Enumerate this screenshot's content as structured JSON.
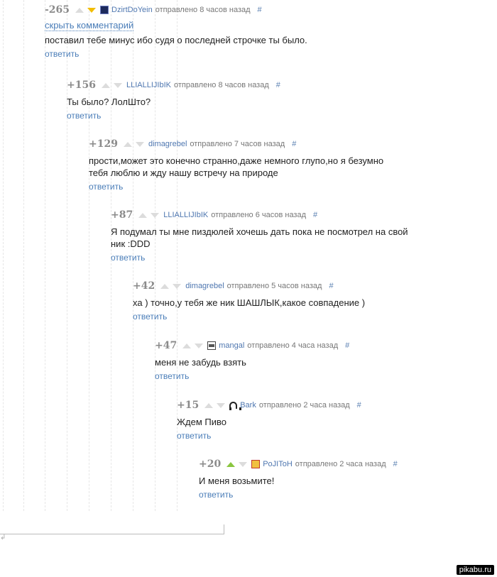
{
  "comments": [
    {
      "rating": "-265",
      "author": "DzirtDoYein",
      "posted": "отправлено 8 часов назад",
      "hash": "#",
      "hide_label": "скрыть комментарий",
      "text": "поставил тебе минус ибо судя о последней строчке ты было.",
      "reply": "ответить",
      "vote": "down",
      "avatar_icon": "night-sky-avatar"
    },
    {
      "rating": "+156",
      "author": "LLIALLIJIbIK",
      "posted": "отправлено 8 часов назад",
      "hash": "#",
      "text": "Ты было? ЛолШто?",
      "reply": "ответить",
      "vote": "none"
    },
    {
      "rating": "+129",
      "author": "dimagrebel",
      "posted": "отправлено 7 часов назад",
      "hash": "#",
      "text": "прости,может это конечно странно,даже немного глупо,но я безумно тебя люблю и жду нашу встречу на природе",
      "reply": "ответить",
      "vote": "none"
    },
    {
      "rating": "+87",
      "author": "LLIALLIJIbIK",
      "posted": "отправлено 6 часов назад",
      "hash": "#",
      "text": "Я подумал ты мне пиздюлей хочешь дать пока не посмотрел на свой ник :DDD",
      "reply": "ответить",
      "vote": "none"
    },
    {
      "rating": "+42",
      "author": "dimagrebel",
      "posted": "отправлено 5 часов назад",
      "hash": "#",
      "text": "ха ) точно,у тебя же ник ШАШЛЫК,какое совпадение )",
      "reply": "ответить",
      "vote": "none"
    },
    {
      "rating": "+47",
      "author": "mangal",
      "posted": "отправлено 4 часа назад",
      "hash": "#",
      "text": "меня не забудь взять",
      "reply": "ответить",
      "vote": "none",
      "avatar_icon": "grill-avatar"
    },
    {
      "rating": "+15",
      "author": "Bark",
      "posted": "отправлено 2 часа назад",
      "hash": "#",
      "text": "Ждем Пиво",
      "reply": "ответить",
      "vote": "none",
      "avatar_icon": "headphones-avatar"
    },
    {
      "rating": "+20",
      "author": "PoJIToH",
      "posted": "отправлено 2 часа назад",
      "hash": "#",
      "text": "И меня возьмите!",
      "reply": "ответить",
      "vote": "up",
      "avatar_icon": "cartoon-avatar"
    }
  ],
  "watermark": "pikabu.ru",
  "colors": {
    "link": "#4a7db8",
    "vote_up_active": "#8ac640",
    "vote_down_active": "#f2bd00",
    "vote_inactive": "#dcdcdc",
    "rating": "#8b8b8b"
  }
}
